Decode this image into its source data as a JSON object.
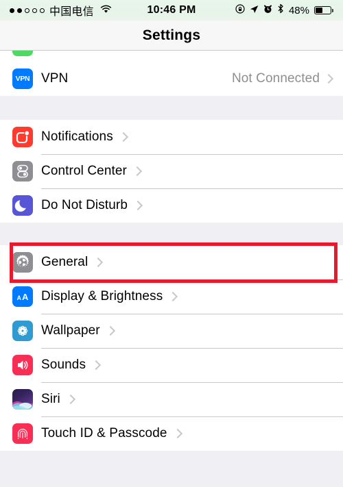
{
  "status_bar": {
    "signal_dots_total": 5,
    "signal_dots_filled": 2,
    "carrier": "中国电信",
    "wifi_icon": "wifi-icon",
    "time": "10:46 PM",
    "right_icons": [
      "rotation-lock-icon",
      "location-arrow-icon",
      "alarm-clock-icon",
      "bluetooth-icon"
    ],
    "battery_percent": "48%",
    "battery_level": 48
  },
  "nav": {
    "title": "Settings"
  },
  "groups": [
    {
      "rows": [
        {
          "icon": "vpn-icon",
          "icon_text": "VPN",
          "label": "VPN",
          "value": "Not Connected",
          "chevron": true
        }
      ]
    },
    {
      "rows": [
        {
          "icon": "notifications-icon",
          "label": "Notifications",
          "value": "",
          "chevron": true
        },
        {
          "icon": "control-center-icon",
          "label": "Control Center",
          "value": "",
          "chevron": true
        },
        {
          "icon": "do-not-disturb-icon",
          "label": "Do Not Disturb",
          "value": "",
          "chevron": true
        }
      ]
    },
    {
      "rows": [
        {
          "icon": "general-gear-icon",
          "label": "General",
          "value": "",
          "chevron": true,
          "highlighted": true
        },
        {
          "icon": "display-brightness-icon",
          "label": "Display & Brightness",
          "value": "",
          "chevron": true
        },
        {
          "icon": "wallpaper-icon",
          "label": "Wallpaper",
          "value": "",
          "chevron": true
        },
        {
          "icon": "sounds-icon",
          "label": "Sounds",
          "value": "",
          "chevron": true
        },
        {
          "icon": "siri-icon",
          "label": "Siri",
          "value": "",
          "chevron": true
        },
        {
          "icon": "touch-id-passcode-icon",
          "label": "Touch ID & Passcode",
          "value": "",
          "chevron": true
        }
      ]
    }
  ],
  "highlight": {
    "color": "#E8192C",
    "target": "General"
  },
  "colors": {
    "group_background": "#FFFFFF",
    "page_background": "#EFEFF4",
    "separator": "#C8C7CC",
    "value_text": "#8E8E93",
    "chevron": "#C7C7CC",
    "status_bar_tint": "#E8F5EA"
  }
}
